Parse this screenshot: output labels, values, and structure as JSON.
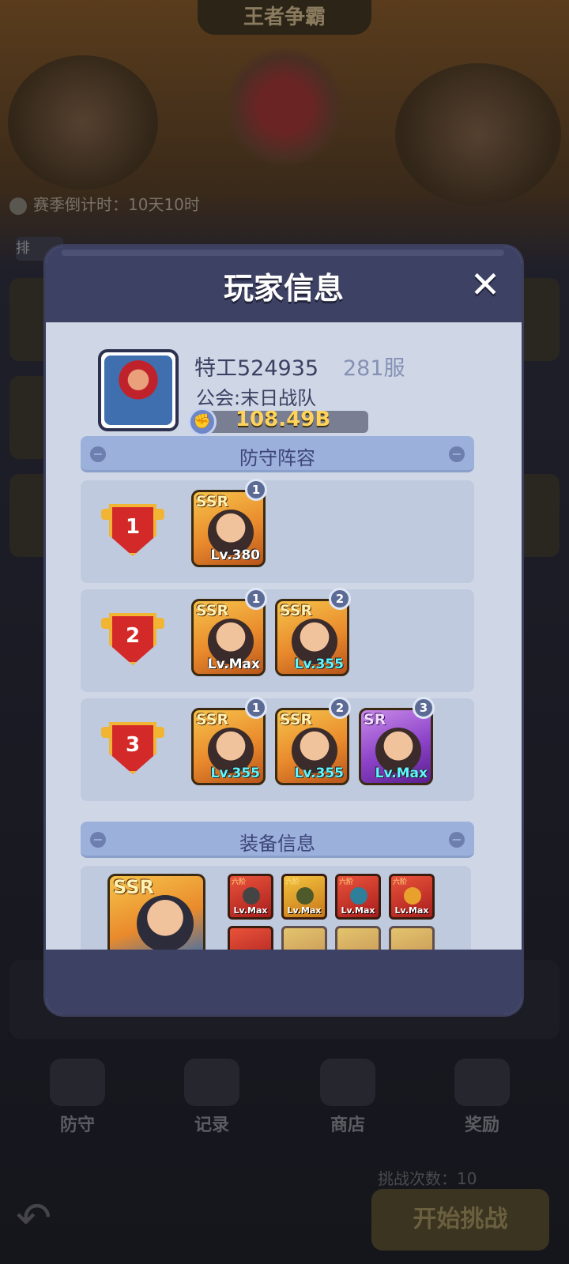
{
  "background": {
    "title": "王者争霸",
    "countdown": "赛季倒计时：10天10时",
    "tab": "排",
    "nav": [
      {
        "label": "防守"
      },
      {
        "label": "记录"
      },
      {
        "label": "商店"
      },
      {
        "label": "奖励"
      }
    ],
    "challenge_count": "挑战次数：10",
    "start_button": "开始挑战"
  },
  "modal": {
    "title": "玩家信息",
    "close_label": "✕",
    "player": {
      "name": "特工524935",
      "server": "281服",
      "guild": "公会:末日战队",
      "power": "108.49B"
    },
    "defense_section": "防守阵容",
    "equipment_section": "装备信息",
    "teams": [
      {
        "rank": "1",
        "heroes": [
          {
            "rarity": "SSR",
            "slot": "1",
            "level": "Lv.380",
            "level_color": "#ffffff"
          }
        ]
      },
      {
        "rank": "2",
        "heroes": [
          {
            "rarity": "SSR",
            "slot": "1",
            "level": "Lv.Max",
            "level_color": "#ffffff"
          },
          {
            "rarity": "SSR",
            "slot": "2",
            "level": "Lv.355",
            "level_color": "#5ff6ff"
          }
        ]
      },
      {
        "rank": "3",
        "heroes": [
          {
            "rarity": "SSR",
            "slot": "1",
            "level": "Lv.355",
            "level_color": "#5ff6ff"
          },
          {
            "rarity": "SSR",
            "slot": "2",
            "level": "Lv.355",
            "level_color": "#5ff6ff"
          },
          {
            "rarity": "SR",
            "slot": "3",
            "level": "Lv.Max",
            "level_color": "#5ff6ff"
          }
        ]
      }
    ],
    "equipment": {
      "hero_rarity": "SSR",
      "items": [
        {
          "tier": "六阶",
          "level": "Lv.Max"
        },
        {
          "tier": "六阶",
          "level": "Lv.Max"
        },
        {
          "tier": "六阶",
          "level": "Lv.Max"
        },
        {
          "tier": "六阶",
          "level": "Lv.Max"
        }
      ]
    }
  }
}
